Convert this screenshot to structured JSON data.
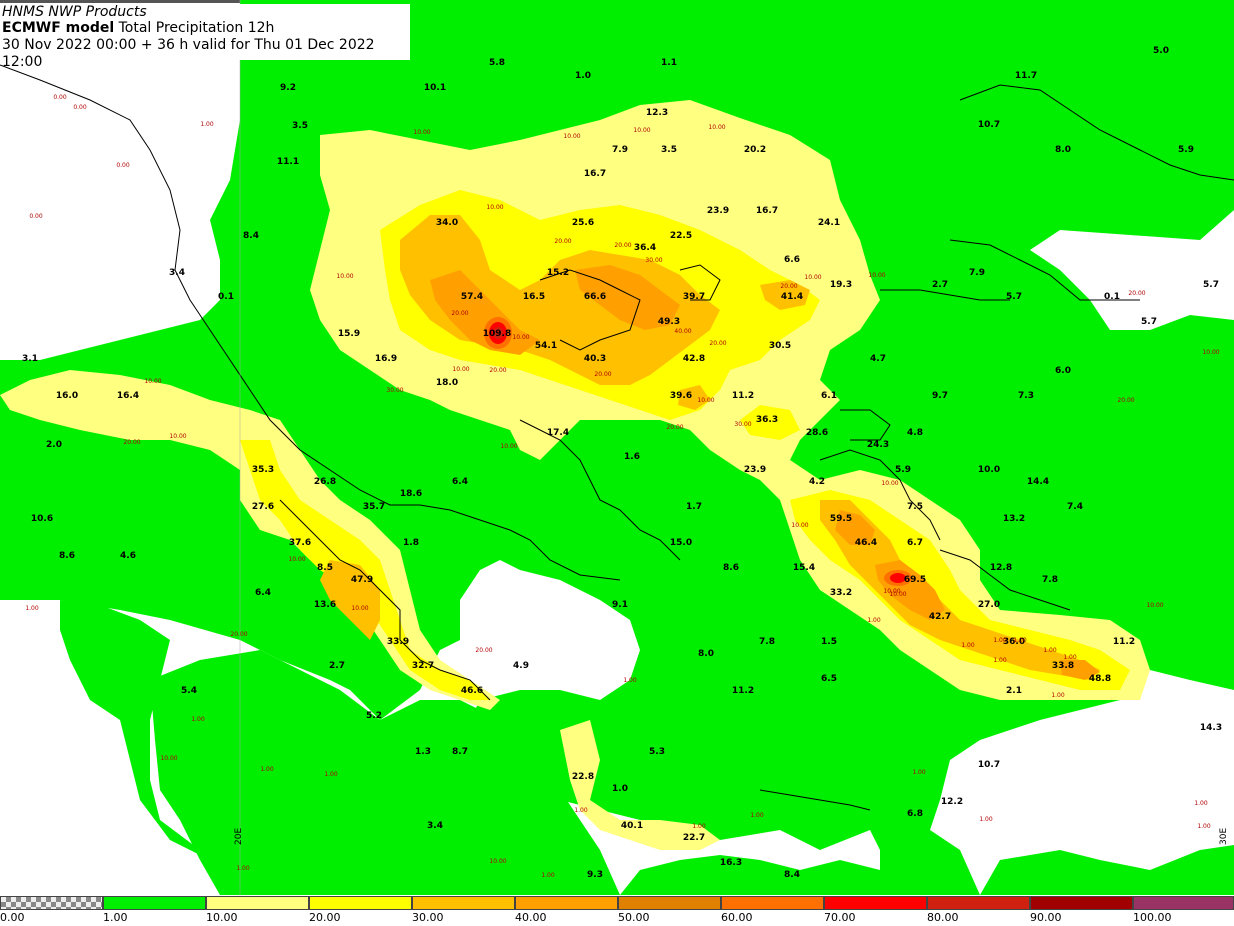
{
  "header": {
    "line1": "HNMS NWP Products",
    "model": "ECMWF model",
    "product": "Total Precipitation 12h",
    "line3": "30 Nov 2022 00:00 + 36 h valid for Thu 01 Dec 2022 12:00"
  },
  "legend": {
    "colors": [
      "#00ee00",
      "#ffff80",
      "#ffff00",
      "#ffc000",
      "#ffa000",
      "#e08000",
      "#ff7000",
      "#ff0000",
      "#d02010",
      "#a00000",
      "#993366"
    ],
    "labels": [
      "0.00",
      "1.00",
      "10.00",
      "20.00",
      "30.00",
      "40.00",
      "50.00",
      "60.00",
      "70.00",
      "80.00",
      "90.00",
      "100.00"
    ]
  },
  "map_labels": {
    "meridian_left": "20E",
    "meridian_right": "30E"
  },
  "values_big": [
    "5.8",
    "1.0",
    "1.1",
    "9.2",
    "10.1",
    "3.5",
    "12.3",
    "11.1",
    "7.9",
    "3.5",
    "20.2",
    "16.7",
    "34.0",
    "25.6",
    "23.9",
    "16.7",
    "24.1",
    "8.4",
    "22.5",
    "36.4",
    "3.4",
    "15.2",
    "6.6",
    "0.1",
    "57.4",
    "16.5",
    "66.6",
    "39.7",
    "41.4",
    "19.3",
    "15.9",
    "109.8",
    "54.1",
    "49.3",
    "16.9",
    "40.3",
    "42.8",
    "30.5",
    "3.1",
    "18.0",
    "16.0",
    "16.4",
    "39.6",
    "11.2",
    "36.3",
    "2.0",
    "17.4",
    "28.6",
    "1.6",
    "24.3",
    "35.3",
    "26.8",
    "6.4",
    "23.9",
    "4.2",
    "18.6",
    "27.6",
    "35.7",
    "1.7",
    "59.5",
    "10.6",
    "37.6",
    "1.8",
    "15.0",
    "46.4",
    "8.6",
    "4.6",
    "8.5",
    "47.9",
    "8.6",
    "15.4",
    "6.4",
    "13.6",
    "9.1",
    "33.2",
    "69.5",
    "42.7",
    "33.9",
    "32.7",
    "2.7",
    "4.9",
    "8.0",
    "7.8",
    "1.5",
    "5.4",
    "46.6",
    "6.5",
    "11.2",
    "5.2",
    "1.3",
    "8.7",
    "5.3",
    "22.8",
    "1.0",
    "3.4",
    "40.1",
    "22.7",
    "16.3",
    "9.3",
    "8.4",
    "5.0",
    "11.7",
    "10.7",
    "8.0",
    "5.9",
    "2.7",
    "5.7",
    "7.9",
    "5.7",
    "0.1",
    "5.7",
    "4.7",
    "6.0",
    "6.1",
    "9.7",
    "7.3",
    "4.8",
    "5.9",
    "10.0",
    "14.4",
    "7.5",
    "13.2",
    "7.4",
    "6.7",
    "12.8",
    "7.8",
    "27.0",
    "36.0",
    "11.2",
    "33.8",
    "48.8",
    "2.1",
    "14.3",
    "10.7",
    "12.2",
    "6.8"
  ],
  "values_small": [
    "0.00",
    "0.00",
    "0.00",
    "1.00",
    "0.00",
    "10.00",
    "10.00",
    "10.00",
    "10.00",
    "10.00",
    "20.00",
    "20.00",
    "30.00",
    "20.00",
    "10.00",
    "10.00",
    "10.00",
    "20.00",
    "10.00",
    "40.00",
    "20.00",
    "10.00",
    "20.00",
    "30.00",
    "20.00",
    "10.00",
    "10.00",
    "20.00",
    "30.00",
    "10.00",
    "20.00",
    "10.00",
    "20.00",
    "10.00",
    "20.00",
    "10.00",
    "10.00",
    "10.00",
    "1.00",
    "10.00",
    "10.00",
    "20.00",
    "20.00",
    "10.00",
    "1.00",
    "1.00",
    "1.00",
    "10.00",
    "1.00",
    "1.00",
    "1.00",
    "1.00",
    "1.00",
    "1.00",
    "1.00",
    "1.00",
    "1.00",
    "10.00",
    "1.00",
    "1.00",
    "1.00",
    "1.00",
    "1.00",
    "1.00",
    "10.00",
    "1.00",
    "1.00",
    "1.00"
  ]
}
